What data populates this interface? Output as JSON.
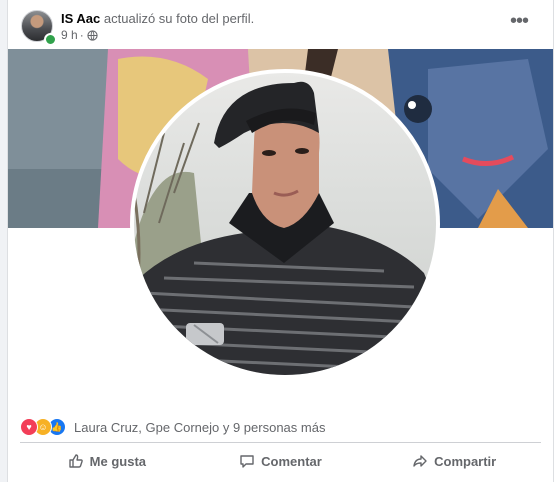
{
  "post": {
    "author": "IS Aac",
    "action_text": "actualizó su foto del perfil.",
    "time": "9 h",
    "separator": "·",
    "privacy_icon": "globe-icon",
    "more_label": "•••"
  },
  "reactions": {
    "icons": [
      "love-reaction-icon",
      "haha-reaction-icon",
      "like-reaction-icon"
    ],
    "summary": "Laura Cruz, Gpe Cornejo y 9 personas más"
  },
  "actions": {
    "like_label": "Me gusta",
    "comment_label": "Comentar",
    "share_label": "Compartir"
  },
  "colors": {
    "online": "#31a24c",
    "love": "#f33e58",
    "haha": "#f7b125",
    "like": "#1877f2",
    "secondary_text": "#65676b"
  }
}
